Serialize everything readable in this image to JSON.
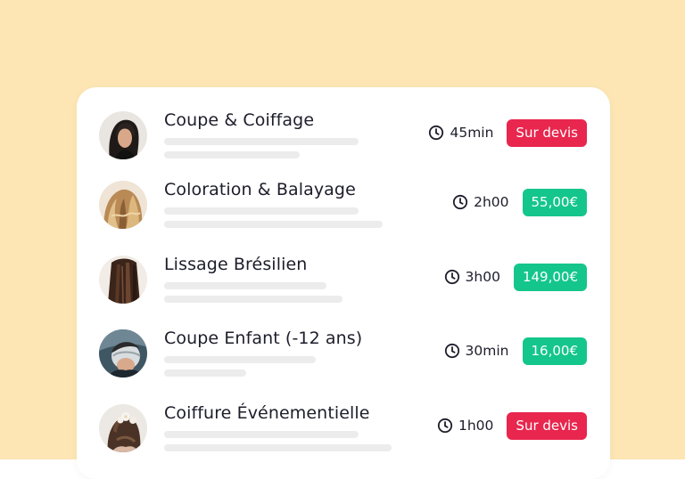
{
  "colors": {
    "background": "#fde6b4",
    "card": "#ffffff",
    "skeleton": "#ececec",
    "quote_badge": "#e8264e",
    "price_badge": "#14c68b",
    "text": "#1d1d2b"
  },
  "services": [
    {
      "title": "Coupe & Coiffage",
      "duration": "45min",
      "badge": "Sur devis",
      "badge_type": "quote",
      "icon": "clock-icon",
      "hair": "dark-short"
    },
    {
      "title": "Coloration & Balayage",
      "duration": "2h00",
      "badge": "55,00€",
      "badge_type": "price",
      "icon": "clock-icon",
      "hair": "blonde-wavy"
    },
    {
      "title": "Lissage Brésilien",
      "duration": "3h00",
      "badge": "149,00€",
      "badge_type": "price",
      "icon": "clock-icon",
      "hair": "dark-straight"
    },
    {
      "title": "Coupe Enfant (-12 ans)",
      "duration": "30min",
      "badge": "16,00€",
      "badge_type": "price",
      "icon": "clock-icon",
      "hair": "kid-fade"
    },
    {
      "title": "Coiffure Événementielle",
      "duration": "1h00",
      "badge": "Sur devis",
      "badge_type": "quote",
      "icon": "clock-icon",
      "hair": "updo-flowers"
    }
  ]
}
